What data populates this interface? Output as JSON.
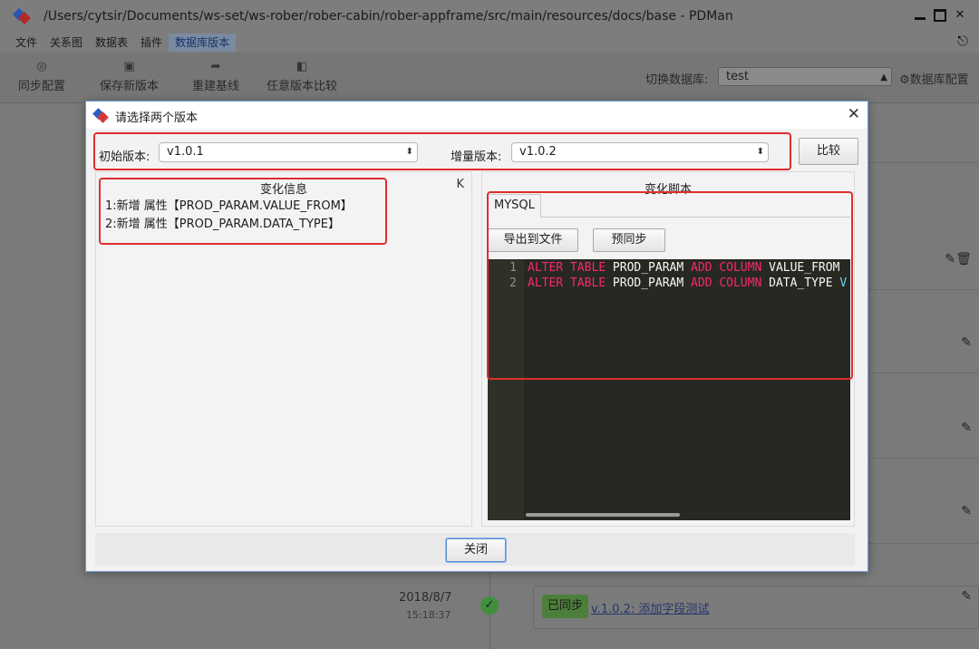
{
  "window": {
    "title": "/Users/cytsir/Documents/ws-set/ws-rober/rober-cabin/rober-appframe/src/main/resources/docs/base - PDMan"
  },
  "menu": [
    "文件",
    "关系图",
    "数据表",
    "插件",
    "数据库版本"
  ],
  "toolbar": {
    "sync": "同步配置",
    "save_version": "保存新版本",
    "rebuild_baseline": "重建基线",
    "compare_any": "任意版本比较",
    "switch_db_label": "切换数据库:",
    "db_value": "test",
    "db_config": "数据库配置"
  },
  "background": {
    "date": "2018/8/7",
    "time": "15:18:37",
    "badge": "已同步",
    "link": "v.1.0.2: 添加字段测试"
  },
  "dialog": {
    "title": "请选择两个版本",
    "initial_label": "初始版本:",
    "initial_value": "v1.0.1",
    "increment_label": "增量版本:",
    "increment_value": "v1.0.2",
    "compare_button": "比较",
    "changes_title": "变化信息",
    "collapse_icon": "K",
    "changes": [
      "1:新增 属性【PROD_PARAM.VALUE_FROM】",
      "2:新增 属性【PROD_PARAM.DATA_TYPE】"
    ],
    "script_title": "变化脚本",
    "tab_label": "MYSQL",
    "export_button": "导出到文件",
    "presync_button": "预同步",
    "close_button": "关闭",
    "code_lines": [
      {
        "n": "1",
        "k1": "ALTER TABLE",
        "t1": " PROD_PARAM ",
        "k2": "ADD COLUMN",
        "t2": " VALUE_FROM",
        "tail": ""
      },
      {
        "n": "2",
        "k1": "ALTER TABLE",
        "t1": " PROD_PARAM ",
        "k2": "ADD COLUMN",
        "t2": " DATA_TYPE ",
        "tail": "V"
      }
    ]
  },
  "colors": {
    "highlight_box": "#e02e2e",
    "editor_bg": "#272822",
    "keyword": "#f92672"
  }
}
